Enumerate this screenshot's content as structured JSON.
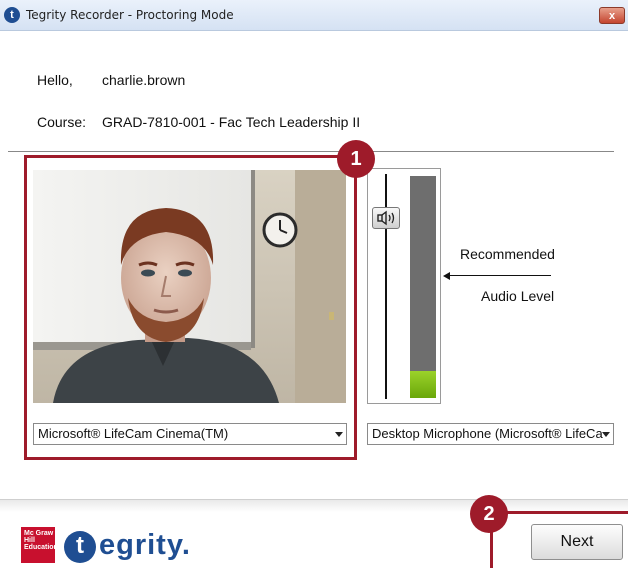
{
  "window": {
    "title": "Tegrity Recorder - Proctoring Mode",
    "close_label": "x"
  },
  "greeting": {
    "label": "Hello,",
    "user": "charlie.brown"
  },
  "course": {
    "label": "Course:",
    "value": "GRAD-7810-001 - Fac Tech Leadership II"
  },
  "audio": {
    "recommended_label": "Recommended",
    "audio_level_label": "Audio Level",
    "level_fraction": 0.12,
    "meter_color": "#7cba12"
  },
  "camera_select": {
    "value": "Microsoft® LifeCam Cinema(TM)"
  },
  "microphone_select": {
    "value": "Desktop Microphone (Microsoft® LifeCa"
  },
  "callouts": {
    "first": "1",
    "second": "2",
    "color": "#9e1b2a"
  },
  "footer": {
    "brand_logo_text": "Mc Graw Hill Education",
    "brand_name": "egrity.",
    "brand_initial": "t",
    "next_label": "Next"
  }
}
